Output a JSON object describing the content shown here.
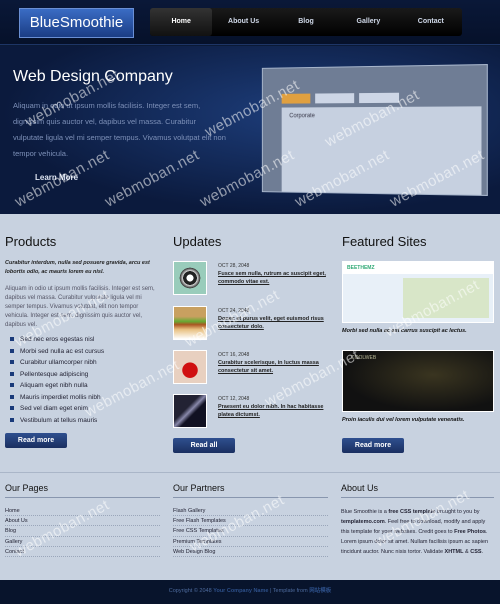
{
  "logo": "BlueSmoothie",
  "nav": [
    "Home",
    "About Us",
    "Blog",
    "Gallery",
    "Contact"
  ],
  "banner": {
    "title": "Web Design Company",
    "text": "Aliquam in odio ut ipsum mollis facilisis. Integer est sem, dignissim quis auctor vel, dapibus vel massa. Curabitur vulputate ligula vel mi semper tempus. Vivamus volutpat elit non tempor vehicula.",
    "button": "Learn More",
    "shot_label": "Corporate"
  },
  "products": {
    "title": "Products",
    "intro": "Curabitur interdum, nulla sed posuere gravida, arcu est lobortis odio, ac mauris lorem eu nisl.",
    "body": "Aliquam in odio ut ipsum mollis facilisis. Integer est sem, dapibus vel massa. Curabitur vulputate ligula vel mi semper tempus. Vivamus volutpat, elit non tempor vehicula. Integer est sem, dignissim quis auctor vel, dapibus vel.",
    "list": [
      "Sed nec eros egestas nisl",
      "Morbi sed nulla ac est cursus",
      "Curabitur ullamcorper nibh",
      "Pellentesque adipiscing",
      "Aliquam eget nibh nulla",
      "Mauris imperdiet mollis nibh",
      "Sed vel diam eget enim",
      "Vestibulum at tellus mauris"
    ],
    "button": "Read more"
  },
  "updates": {
    "title": "Updates",
    "items": [
      {
        "date": "OCT 28, 2048",
        "title": "Fusce sem nulla, rutrum ac suscipit eget, commodo vitae est."
      },
      {
        "date": "OCT 24, 2048",
        "title": "Donec et purus velit, eget euismod risus consectetur dolo."
      },
      {
        "date": "OCT 16, 2048",
        "title": "Curabitur scelerisque, in luctus massa consectetur sit amet."
      },
      {
        "date": "OCT 12, 2048",
        "title": "Praesent eu dolor nibh. In hac habitasse platea dictumst."
      }
    ],
    "button": "Read all"
  },
  "featured": {
    "title": "Featured Sites",
    "items": [
      {
        "caption": "Morbi sed nulla ac est carrus suscipit ac lectus.",
        "label": "BEETHEMZ"
      },
      {
        "caption": "Proin iaculis dui vel lorem vulputate venenatis.",
        "label": "COOLWEB"
      }
    ],
    "button": "Read more"
  },
  "footer": {
    "pages_title": "Our Pages",
    "pages": [
      "Home",
      "About Us",
      "Blog",
      "Gallery",
      "Contact"
    ],
    "partners_title": "Our Partners",
    "partners": [
      "Flash Gallery",
      "Free Flash Templates",
      "Free CSS Templates",
      "Premium Templates",
      "Web Design Blog"
    ],
    "about_title": "About Us",
    "about_text_1": "Blue Smoothie is a ",
    "about_bold_1": "free CSS template",
    "about_text_2": " brought to you by ",
    "about_bold_2": "templatemo.com",
    "about_text_3": ". Feel free to download, modify and apply this template for your websites. Credit goes to ",
    "about_bold_3": "Free Photos",
    "about_text_4": ". Lorem ipsum dolor sit amet. Nullam facilisis ipsum ac sapien tincidunt auctor. Nunc nisis tortor. Validate ",
    "about_bold_4": "XHTML",
    "about_text_5": " & ",
    "about_bold_5": "CSS",
    "about_text_6": "."
  },
  "bottom": {
    "prefix": "Copyright © 2048 ",
    "company": "Your Company Name",
    "middle": " | Template from ",
    "source": "网站模板"
  },
  "watermark": "webmoban.net"
}
